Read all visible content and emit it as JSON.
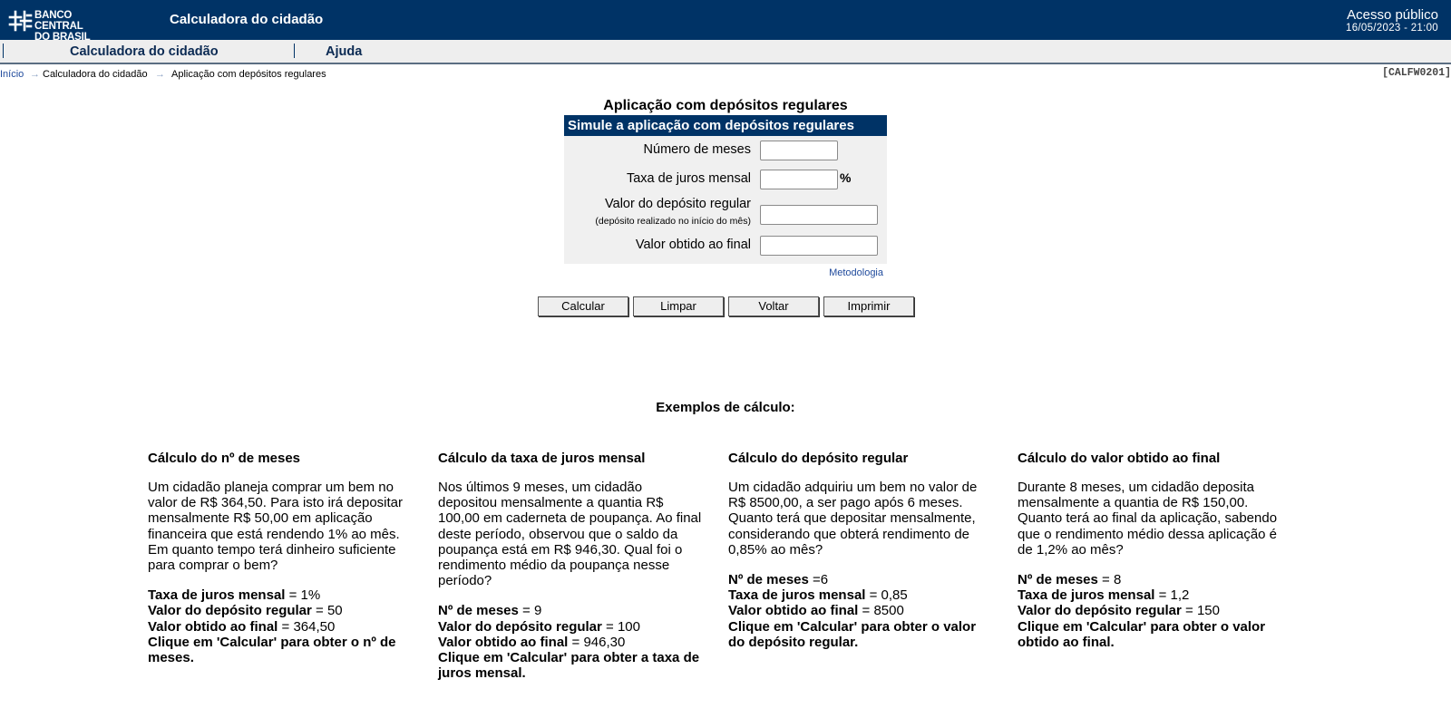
{
  "header": {
    "logo_line1": "BANCO CENTRAL",
    "logo_line2": "DO BRASIL",
    "app_title": "Calculadora do cidadão",
    "access_label": "Acesso público",
    "access_datetime": "16/05/2023 - 21:00"
  },
  "nav": {
    "items": [
      "Calculadora do cidadão",
      "Ajuda"
    ]
  },
  "breadcrumb": {
    "items": [
      "Início",
      "Calculadora do cidadão",
      "Aplicação com depósitos regulares"
    ],
    "separator": "→"
  },
  "screen_code": "[CALFW0201]",
  "form": {
    "title": "Aplicação com depósitos regulares",
    "header": "Simule a aplicação com depósitos regulares",
    "fields": [
      {
        "label": "Número de meses",
        "value": ""
      },
      {
        "label": "Taxa de juros mensal",
        "value": "",
        "suffix": "%"
      },
      {
        "label": "Valor do depósito regular",
        "sublabel": "(depósito realizado no início do mês)",
        "value": ""
      },
      {
        "label": "Valor obtido ao final",
        "value": ""
      }
    ],
    "metodologia_link": "Metodologia",
    "buttons": [
      "Calcular",
      "Limpar",
      "Voltar",
      "Imprimir"
    ]
  },
  "examples": {
    "title": "Exemplos de cálculo:",
    "columns": [
      {
        "title": "Cálculo do nº de meses",
        "text": "Um cidadão planeja comprar um bem no valor de R$ 364,50. Para isto irá depositar mensalmente R$ 50,00 em aplicação financeira que está rendendo 1% ao mês. Em quanto tempo terá dinheiro suficiente para comprar o bem?",
        "params": [
          {
            "label": "Taxa de juros mensal",
            "value": " = 1%"
          },
          {
            "label": "Valor do depósito regular",
            "value": " = 50"
          },
          {
            "label": "Valor obtido ao final",
            "value": " = 364,50"
          }
        ],
        "note": "Clique em 'Calcular' para obter o nº de meses."
      },
      {
        "title": "Cálculo da taxa de juros mensal",
        "text": "Nos últimos 9 meses, um cidadão depositou mensalmente a quantia R$ 100,00 em caderneta de poupança. Ao final deste período, observou que o saldo da poupança está em R$ 946,30. Qual foi o rendimento médio da poupança nesse período?",
        "params": [
          {
            "label": "Nº de meses",
            "value": " = 9"
          },
          {
            "label": "Valor do depósito regular",
            "value": " = 100"
          },
          {
            "label": "Valor obtido ao final",
            "value": " = 946,30"
          }
        ],
        "note": "Clique em 'Calcular' para obter a taxa de juros mensal."
      },
      {
        "title": "Cálculo do depósito regular",
        "text": "Um cidadão adquiriu um bem no valor de R$ 8500,00, a ser pago após 6 meses. Quanto terá que depositar mensalmente, considerando que obterá rendimento de 0,85% ao mês?",
        "params": [
          {
            "label": "Nº de meses",
            "value": " =6"
          },
          {
            "label": "Taxa de juros mensal",
            "value": " = 0,85"
          },
          {
            "label": "Valor obtido ao final",
            "value": " = 8500"
          }
        ],
        "note": "Clique em 'Calcular' para obter o valor do depósito regular."
      },
      {
        "title": "Cálculo do valor obtido ao final",
        "text": "Durante 8 meses, um cidadão deposita mensalmente a quantia de R$ 150,00. Quanto terá ao final da aplicação, sabendo que o rendimento médio dessa aplicação é de 1,2% ao mês?",
        "params": [
          {
            "label": "Nº de meses",
            "value": " = 8"
          },
          {
            "label": "Taxa de juros mensal",
            "value": " = 1,2"
          },
          {
            "label": "Valor do depósito regular",
            "value": " = 150"
          }
        ],
        "note": "Clique em 'Calcular' para obter o valor obtido ao final."
      }
    ]
  },
  "colors": {
    "primary": "#003366",
    "link": "#1f4a9c",
    "nav_bg": "#eeeeee"
  }
}
